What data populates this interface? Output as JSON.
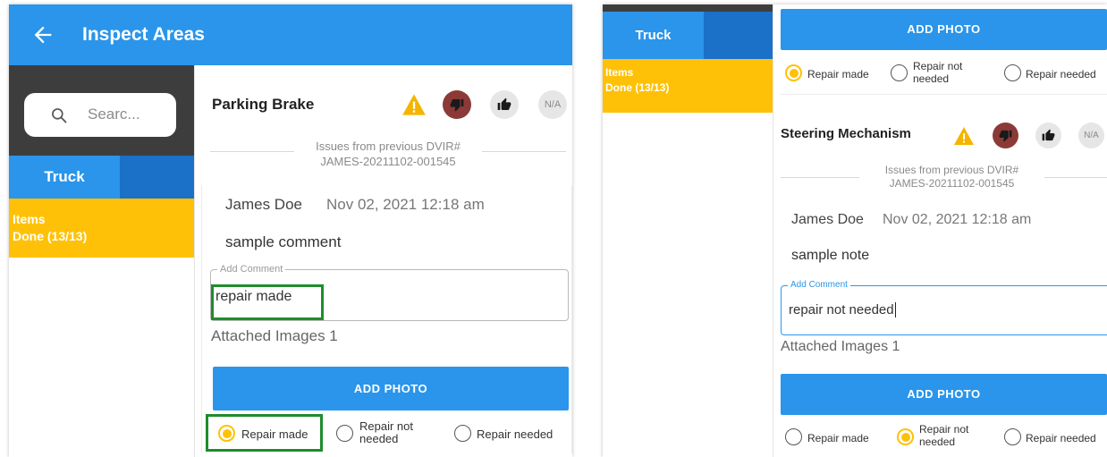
{
  "left": {
    "appbar": {
      "title": "Inspect Areas"
    },
    "search": {
      "placeholder": "Searc..."
    },
    "tab": {
      "label": "Truck"
    },
    "items": {
      "label": "Items",
      "status": "Done (13/13)"
    },
    "item": {
      "title": "Parking Brake",
      "na_label": "N/A",
      "previous_issue_line1": "Issues from previous DVIR#",
      "previous_issue_line2": "JAMES-20211102-001545",
      "comment_author": "James Doe",
      "comment_date": "Nov 02, 2021  12:18 am",
      "comment_text": "sample comment",
      "add_comment_label": "Add Comment",
      "add_comment_value": "repair made",
      "attached_images": "Attached Images 1",
      "add_photo_label": "ADD PHOTO",
      "radio_options": [
        "Repair made",
        "Repair not needed",
        "Repair needed"
      ],
      "radio_not_needed_line1": "Repair not",
      "radio_not_needed_line2": "needed",
      "selected_option": "Repair made"
    }
  },
  "right": {
    "tab": {
      "label": "Truck"
    },
    "items": {
      "label": "Items",
      "status": "Done (13/13)"
    },
    "top_add_photo_label": "ADD PHOTO",
    "top_radio_options": [
      "Repair made",
      "Repair not needed",
      "Repair needed"
    ],
    "top_radio_not_needed_line1": "Repair not",
    "top_radio_not_needed_line2": "needed",
    "top_selected_option": "Repair made",
    "item": {
      "title": "Steering Mechanism",
      "na_label": "N/A",
      "previous_issue_line1": "Issues from previous DVIR#",
      "previous_issue_line2": "JAMES-20211102-001545",
      "comment_author": "James Doe",
      "comment_date": "Nov 02, 2021  12:18 am",
      "comment_text": "sample note",
      "add_comment_label": "Add Comment",
      "add_comment_value": "repair not needed",
      "attached_images": "Attached Images 1",
      "add_photo_label": "ADD PHOTO",
      "radio_options": [
        "Repair made",
        "Repair not needed",
        "Repair needed"
      ],
      "radio_not_needed_line1": "Repair not",
      "radio_not_needed_line2": "needed",
      "selected_option": "Repair not needed"
    }
  },
  "colors": {
    "primary_blue": "#2a95ea",
    "dark_tab_blue": "#1b70c8",
    "items_yellow": "#ffc107",
    "thumb_down_red": "#8b3a37",
    "highlight_green": "#1f8c2c"
  }
}
